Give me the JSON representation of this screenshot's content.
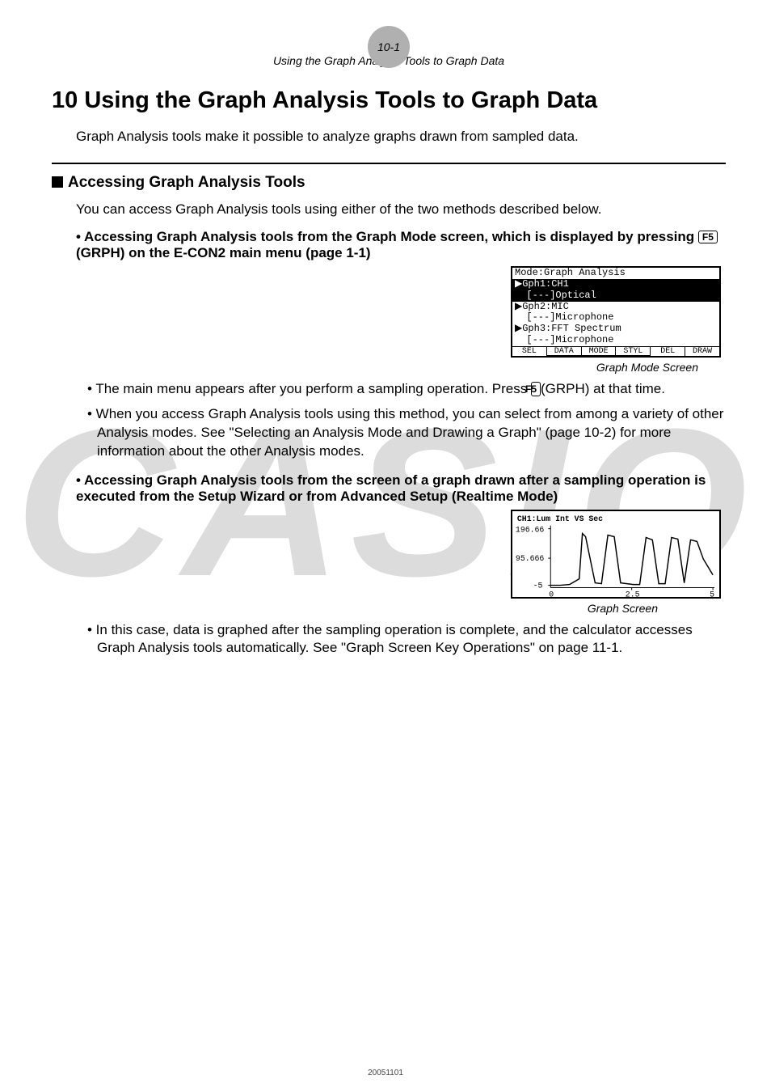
{
  "header": {
    "page_ref": "10-1",
    "running": "Using the Graph Analysis Tools to Graph Data"
  },
  "watermark": "CASIO",
  "title": "10 Using the Graph Analysis Tools to Graph Data",
  "intro": "Graph Analysis tools make it possible to analyze graphs drawn from sampled data.",
  "section1": {
    "heading": "Accessing Graph Analysis Tools",
    "lead": "You can access Graph Analysis tools using either of the two methods described below.",
    "method_a_pre": "•  Accessing Graph Analysis tools from the Graph Mode screen, which is displayed by pressing ",
    "method_a_key": "F5",
    "method_a_post": "(GRPH) on the E-CON2 main menu (page 1-1)",
    "lcd1": {
      "l0": "Mode:Graph Analysis",
      "l1": "▶Gph1:CH1",
      "l2": "  [---]Optical",
      "l3": "▶Gph2:MIC",
      "l4": "  [---]Microphone",
      "l5": "▶Gph3:FFT Spectrum",
      "l6": "  [---]Microphone",
      "f1": "SEL",
      "f2": "DATA",
      "f3": "MODE",
      "f4": "STYL",
      "f5": "DEL",
      "f6": "DRAW"
    },
    "cap1": "Graph Mode Screen",
    "note_a1_pre": "• The main menu appears after you perform a sampling operation. Press ",
    "note_a1_key": "F5",
    "note_a1_post": "(GRPH) at that time.",
    "note_a2": "• When you access Graph Analysis tools using this method, you can select from among a variety of other Analysis modes. See \"Selecting an Analysis Mode and Drawing a Graph\" (page 10-2) for more information about the other Analysis modes.",
    "method_b": "•  Accessing Graph Analysis tools from the screen of a graph drawn after a sampling operation is executed from the Setup Wizard or from Advanced Setup (Realtime Mode)",
    "lcd2": {
      "title": "CH1:Lum Int VS Sec",
      "y_top": "196.66",
      "y_mid": "95.666",
      "y_bot": "-5",
      "x0": "0",
      "x_mid": "2.5",
      "x_end": "5"
    },
    "cap2": "Graph Screen",
    "note_b1": "• In this case, data is graphed after the sampling operation is complete, and the calculator accesses Graph Analysis tools automatically. See \"Graph Screen Key Operations\" on page 11-1."
  },
  "footer_code": "20051101",
  "chart_data": {
    "type": "line",
    "title": "CH1:Lum Int VS Sec",
    "xlabel": "Sec",
    "ylabel": "Lum Int",
    "xlim": [
      0,
      5
    ],
    "ylim": [
      -5,
      196.66
    ],
    "x_ticks": [
      0,
      2.5,
      5
    ],
    "y_ticks": [
      -5,
      95.666,
      196.66
    ],
    "series": [
      {
        "name": "CH1",
        "x": [
          0.0,
          0.3,
          0.6,
          0.9,
          1.0,
          1.1,
          1.4,
          1.6,
          1.8,
          2.0,
          2.2,
          2.4,
          2.6,
          2.8,
          3.0,
          3.2,
          3.4,
          3.6,
          3.8,
          4.0,
          4.2,
          4.4,
          4.6,
          4.8,
          5.0
        ],
        "values": [
          0,
          0,
          2,
          20,
          170,
          150,
          10,
          8,
          160,
          155,
          15,
          10,
          5,
          5,
          150,
          140,
          10,
          8,
          150,
          145,
          15,
          140,
          135,
          90,
          40
        ]
      }
    ]
  }
}
